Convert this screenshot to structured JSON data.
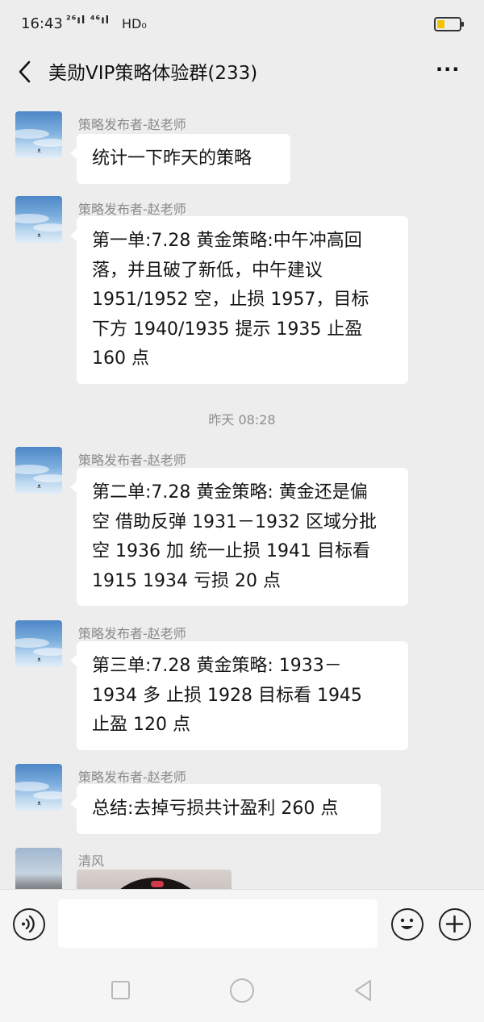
{
  "status_bar": {
    "time": "16:43",
    "signal_text": "²⁶ıl ⁴⁶ıl",
    "hd_text": "HD₀"
  },
  "nav": {
    "title": "美勋VIP策略体验群(233)",
    "more": "···"
  },
  "messages": [
    {
      "sender": "策略发布者-赵老师",
      "text": "统计一下昨天的策略"
    },
    {
      "sender": "策略发布者-赵老师",
      "text": "第一单:7.28 黄金策略:中午冲高回\n落，并且破了新低，中午建议\n1951/1952 空，止损 1957，目标\n下方 1940/1935  提示 1935 止盈\n160 点"
    },
    {
      "sender": "策略发布者-赵老师",
      "text": "第二单:7.28 黄金策略: 黄金还是偏\n空 借助反弹 1931－1932 区域分批\n空  1936 加 统一止损 1941 目标看\n1915 1934 亏损 20 点"
    },
    {
      "sender": "策略发布者-赵老师",
      "text": "第三单:7.28 黄金策略: 1933－\n1934 多 止损 1928 目标看 1945\n止盈 120 点"
    },
    {
      "sender": "策略发布者-赵老师",
      "text": "总结:去掉亏损共计盈利 260 点"
    },
    {
      "sender": "清风"
    }
  ],
  "timestamp": "昨天 08:28",
  "input": {
    "value": ""
  }
}
